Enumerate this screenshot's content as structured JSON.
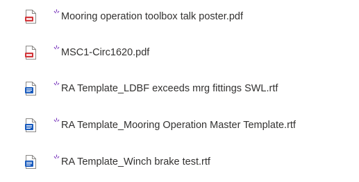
{
  "files": [
    {
      "name": "Mooring operation toolbox talk poster.pdf",
      "icon": "pdf-file-icon",
      "is_new": true
    },
    {
      "name": "MSC1-Circ1620.pdf",
      "icon": "pdf-file-icon",
      "is_new": true
    },
    {
      "name": "RA Template_LDBF exceeds mrg fittings SWL.rtf",
      "icon": "rtf-file-icon",
      "is_new": true
    },
    {
      "name": "RA Template_Mooring Operation Master Template.rtf",
      "icon": "rtf-file-icon",
      "is_new": true
    },
    {
      "name": "RA Template_Winch brake test.rtf",
      "icon": "rtf-file-icon",
      "is_new": true
    }
  ],
  "colors": {
    "pdf_accent": "#d13438",
    "rtf_accent": "#185abd",
    "new_indicator": "#7f3fbf",
    "text": "#323130"
  }
}
